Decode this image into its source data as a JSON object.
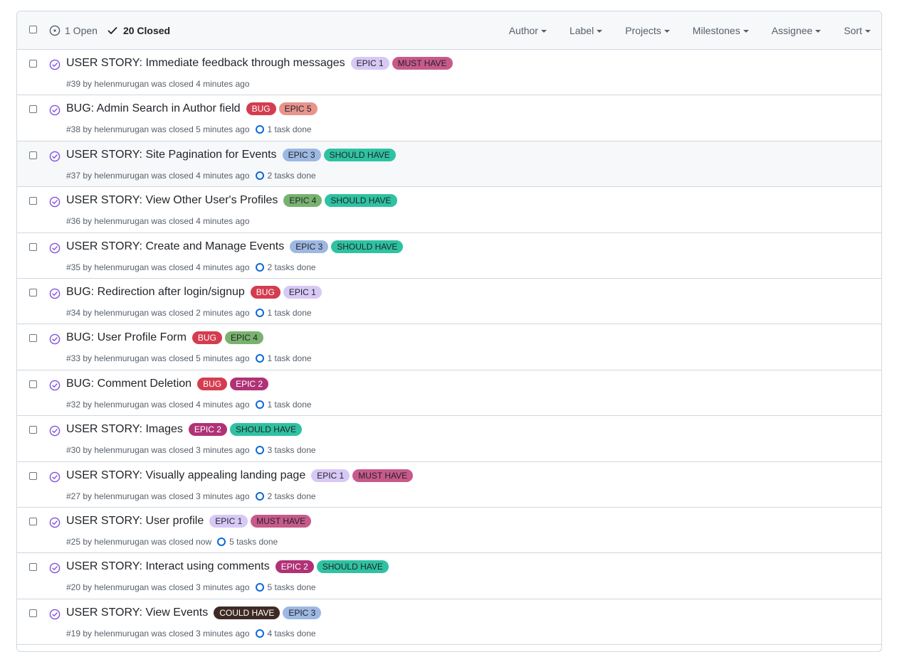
{
  "header": {
    "open_label": "1 Open",
    "closed_label": "20 Closed",
    "filters": [
      "Author",
      "Label",
      "Projects",
      "Milestones",
      "Assignee",
      "Sort"
    ]
  },
  "colors": {
    "closed_icon": "#8250df",
    "EPIC 1": "#d8c8f6",
    "EPIC 2": "#b03276",
    "EPIC 3": "#9db8e2",
    "EPIC 4": "#79b26f",
    "EPIC 5": "#e8938b",
    "MUST HAVE": "#c85a8a",
    "SHOULD HAVE": "#2fc2a2",
    "COULD HAVE": "#3d2a24",
    "BUG": "#d43c4f"
  },
  "issues": [
    {
      "title": "USER STORY: Immediate feedback through messages",
      "labels": [
        "EPIC 1",
        "MUST HAVE"
      ],
      "meta": "#39 by helenmurugan was closed 4 minutes ago",
      "tasks": ""
    },
    {
      "title": "BUG: Admin Search in Author field",
      "labels": [
        "BUG",
        "EPIC 5"
      ],
      "meta": "#38 by helenmurugan was closed 5 minutes ago",
      "tasks": "1 task done"
    },
    {
      "title": "USER STORY: Site Pagination for Events",
      "labels": [
        "EPIC 3",
        "SHOULD HAVE"
      ],
      "meta": "#37 by helenmurugan was closed 4 minutes ago",
      "tasks": "2 tasks done"
    },
    {
      "title": "USER STORY: View Other User's Profiles",
      "labels": [
        "EPIC 4",
        "SHOULD HAVE"
      ],
      "meta": "#36 by helenmurugan was closed 4 minutes ago",
      "tasks": ""
    },
    {
      "title": "USER STORY: Create and Manage Events",
      "labels": [
        "EPIC 3",
        "SHOULD HAVE"
      ],
      "meta": "#35 by helenmurugan was closed 4 minutes ago",
      "tasks": "2 tasks done"
    },
    {
      "title": "BUG: Redirection after login/signup",
      "labels": [
        "BUG",
        "EPIC 1"
      ],
      "meta": "#34 by helenmurugan was closed 2 minutes ago",
      "tasks": "1 task done"
    },
    {
      "title": "BUG: User Profile Form",
      "labels": [
        "BUG",
        "EPIC 4"
      ],
      "meta": "#33 by helenmurugan was closed 5 minutes ago",
      "tasks": "1 task done"
    },
    {
      "title": "BUG: Comment Deletion",
      "labels": [
        "BUG",
        "EPIC 2"
      ],
      "meta": "#32 by helenmurugan was closed 4 minutes ago",
      "tasks": "1 task done"
    },
    {
      "title": "USER STORY: Images",
      "labels": [
        "EPIC 2",
        "SHOULD HAVE"
      ],
      "meta": "#30 by helenmurugan was closed 3 minutes ago",
      "tasks": "3 tasks done"
    },
    {
      "title": "USER STORY: Visually appealing landing page",
      "labels": [
        "EPIC 1",
        "MUST HAVE"
      ],
      "meta": "#27 by helenmurugan was closed 3 minutes ago",
      "tasks": "2 tasks done"
    },
    {
      "title": "USER STORY: User profile",
      "labels": [
        "EPIC 1",
        "MUST HAVE"
      ],
      "meta": "#25 by helenmurugan was closed now",
      "tasks": "5 tasks done"
    },
    {
      "title": "USER STORY: Interact using comments",
      "labels": [
        "EPIC 2",
        "SHOULD HAVE"
      ],
      "meta": "#20 by helenmurugan was closed 3 minutes ago",
      "tasks": "5 tasks done"
    },
    {
      "title": "USER STORY: View Events",
      "labels": [
        "COULD HAVE",
        "EPIC 3"
      ],
      "meta": "#19 by helenmurugan was closed 3 minutes ago",
      "tasks": "4 tasks done"
    }
  ]
}
